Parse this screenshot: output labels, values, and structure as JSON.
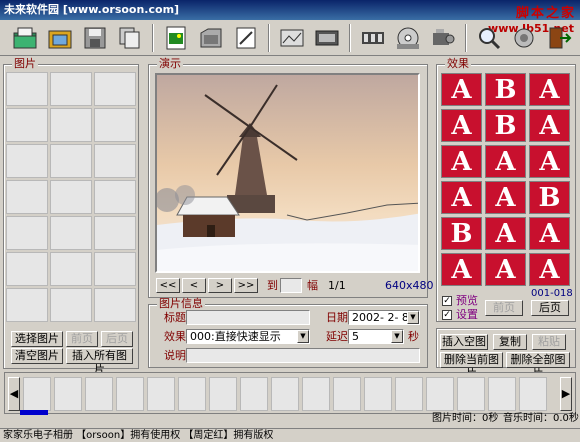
{
  "window": {
    "title": "未来软件园",
    "url": "[www.orsoon.com]"
  },
  "watermark": {
    "text1": "脚本之家",
    "text2": "www.Jb51.net"
  },
  "toolbar": {
    "icons": [
      "open-folder-icon",
      "folder-icon",
      "save-icon",
      "copy-pages-icon",
      "image-file-icon",
      "open-file-icon",
      "edit-image-icon",
      "picture-icon",
      "film-icon",
      "film-strip-icon",
      "cd-music-icon",
      "projector-icon",
      "search-icon",
      "settings-icon",
      "exit-icon"
    ]
  },
  "panels": {
    "pictures": "图片",
    "preview": "演示",
    "effects": "效果",
    "picinfo": "图片信息"
  },
  "picButtons": {
    "select": "选择图片",
    "prev": "前页",
    "next": "后页",
    "clear": "清空图片",
    "insertAll": "插入所有图片"
  },
  "nav": {
    "first": "<<",
    "prev": "<",
    "next": ">",
    "last": ">>",
    "goto": "到",
    "frameUnit": "幅",
    "page": "1/1",
    "resolution": "640x480"
  },
  "info": {
    "titleLabel": "标题",
    "titleValue": "",
    "dateLabel": "日期",
    "dateValue": "2002- 2- 8",
    "effectLabel": "效果",
    "effectValue": "000:直接快速显示",
    "delayLabel": "延迟",
    "delayValue": "5",
    "delayUnit": "秒",
    "descLabel": "说明",
    "descValue": ""
  },
  "effects": {
    "letters": [
      "A",
      "B",
      "A",
      "A",
      "B",
      "A",
      "A",
      "A",
      "A",
      "A",
      "A",
      "B",
      "B",
      "A",
      "A",
      "A",
      "A",
      "A"
    ],
    "range": "001-018",
    "previewLabel": "预览",
    "previewChecked": true,
    "settingsLabel": "设置",
    "settingsChecked": true,
    "prevBtn": "前页",
    "nextBtn": "后页"
  },
  "actions": {
    "insertEmpty": "插入空图",
    "copy": "复制",
    "paste": "粘贴",
    "deleteCurrent": "删除当前图片",
    "deleteAll": "删除全部图片"
  },
  "timeline": {
    "picTime": "图片时间：0秒",
    "musicTime": "音乐时间：0.0秒"
  },
  "status": {
    "text": "家家乐电子相册  【orsoon】拥有使用权  【周定红】拥有版权"
  },
  "colors": {
    "accent": "#800000",
    "titlebar": "#0a246a",
    "effectRed": "#c8102e",
    "progress": "#0000cc"
  }
}
